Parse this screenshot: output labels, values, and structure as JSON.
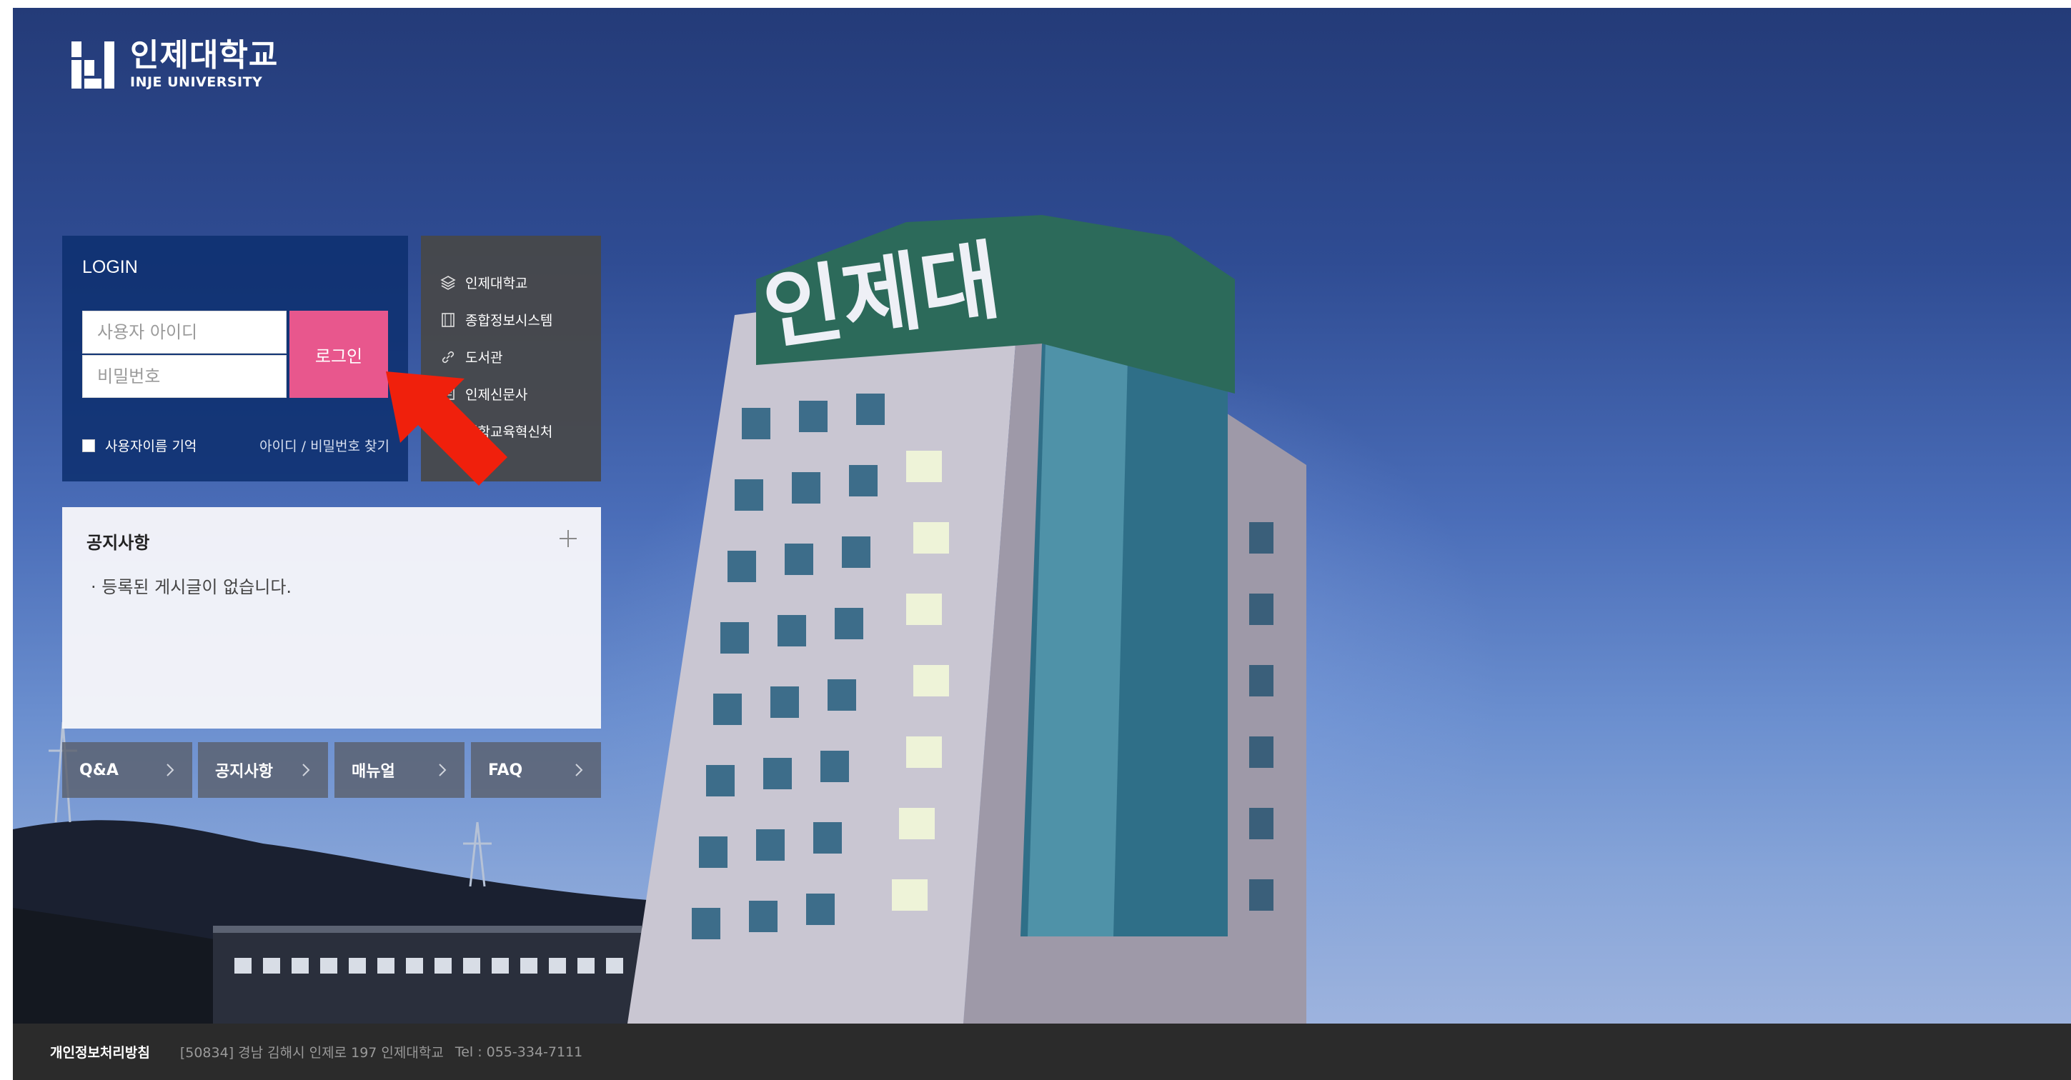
{
  "logo": {
    "ko": "인제대학교",
    "en": "INJE UNIVERSITY"
  },
  "login": {
    "title": "LOGIN",
    "user_id_placeholder": "사용자 아이디",
    "password_placeholder": "비밀번호",
    "button_label": "로그인",
    "remember_label": "사용자이름 기억",
    "find_link": "아이디 / 비밀번호 찾기"
  },
  "quick_links": [
    {
      "label": "인제대학교",
      "icon": "layers-icon"
    },
    {
      "label": "종합정보시스템",
      "icon": "film-icon"
    },
    {
      "label": "도서관",
      "icon": "link-icon"
    },
    {
      "label": "인제신문사",
      "icon": "newspaper-icon"
    },
    {
      "label": "대학교육혁신처",
      "icon": "building-icon"
    }
  ],
  "notice": {
    "title": "공지사항",
    "empty_message": "·  등록된 게시글이 없습니다."
  },
  "tiles": [
    {
      "label": "Q&A"
    },
    {
      "label": "공지사항"
    },
    {
      "label": "매뉴얼"
    },
    {
      "label": "FAQ"
    }
  ],
  "footer": {
    "privacy": "개인정보처리방침",
    "address": "[50834] 경남 김해시 인제로 197 인제대학교",
    "tel": "Tel : 055-334-7111"
  },
  "building_sign": "인제대",
  "colors": {
    "login_bg": "#0e3070",
    "login_button": "#e8578d",
    "quick_bg": "#484848",
    "footer_bg": "#2b2b2b",
    "arrow": "#f0200c"
  }
}
